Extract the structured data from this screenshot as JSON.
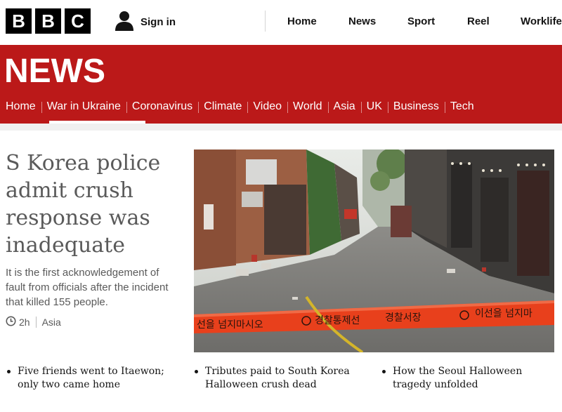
{
  "masthead": {
    "logo_letters": [
      "B",
      "B",
      "C"
    ],
    "signin_label": "Sign in",
    "nav": [
      "Home",
      "News",
      "Sport",
      "Reel",
      "Worklife"
    ]
  },
  "section": {
    "title": "NEWS",
    "subnav": [
      "Home",
      "War in Ukraine",
      "Coronavirus",
      "Climate",
      "Video",
      "World",
      "Asia",
      "UK",
      "Business",
      "Tech"
    ],
    "active_item": "War in Ukraine"
  },
  "lead": {
    "headline": "S Korea police admit crush response was inadequate",
    "summary": "It is the first acknowledgement of fault from officials after the incident that killed 155 people.",
    "time": "2h",
    "tag": "Asia"
  },
  "image": {
    "tape_text": [
      "선을 넘지마시오",
      "경찰통제선",
      "경찰서장",
      "이선을 넘지마"
    ]
  },
  "related": [
    "Five friends went to Itaewon; only two came home",
    "Tributes paid to South Korea Halloween crush dead",
    "How the Seoul Halloween tragedy unfolded"
  ],
  "colors": {
    "brand_red": "#bb1919",
    "text_gray": "#5a5a5a",
    "tape_orange": "#e8401c"
  }
}
